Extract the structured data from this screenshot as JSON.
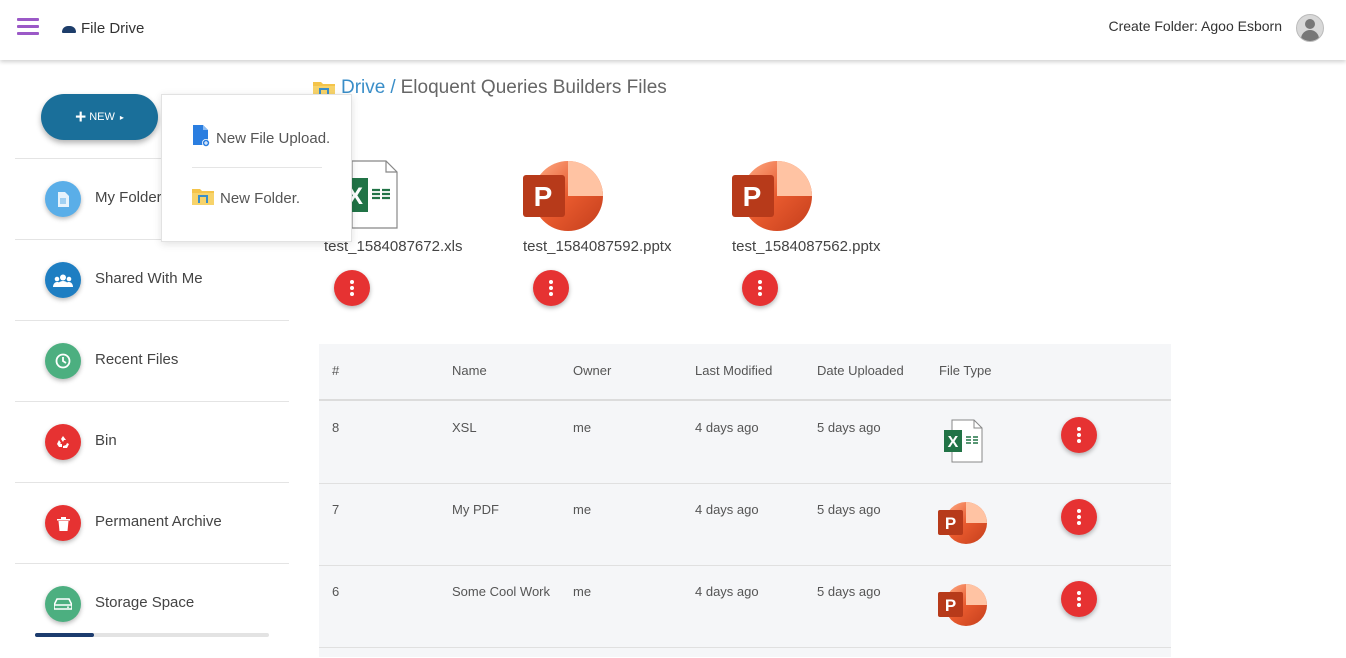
{
  "header": {
    "brand": "File Drive",
    "create_folder": "Create Folder: Agoo Esborn"
  },
  "sidebar": {
    "new_label": "NEW",
    "items": [
      {
        "label": "My Folders",
        "icon": "file-icon",
        "color": "#5aaee8"
      },
      {
        "label": "Shared With Me",
        "icon": "group-icon",
        "color": "#1e7ec2"
      },
      {
        "label": "Recent Files",
        "icon": "clock-icon",
        "color": "#4caf80"
      },
      {
        "label": "Bin",
        "icon": "recycle-icon",
        "color": "#e63232"
      },
      {
        "label": "Permanent Archive",
        "icon": "trash-icon",
        "color": "#e63232"
      },
      {
        "label": "Storage Space",
        "icon": "drive-icon",
        "color": "#4caf80"
      }
    ],
    "storage_used_fraction": 0.25
  },
  "dropdown": {
    "items": [
      {
        "label": "New File Upload.",
        "icon": "file-upload-icon"
      },
      {
        "label": "New Folder.",
        "icon": "folder-icon"
      }
    ]
  },
  "breadcrumb": {
    "root": "Drive",
    "separator": "/",
    "current": "Eloquent Queries Builders Files"
  },
  "files": [
    {
      "name": "test_1584087672.xls",
      "type": "excel"
    },
    {
      "name": "test_1584087592.pptx",
      "type": "powerpoint"
    },
    {
      "name": "test_1584087562.pptx",
      "type": "powerpoint"
    }
  ],
  "table": {
    "headers": [
      "#",
      "Name",
      "Owner",
      "Last Modified",
      "Date Uploaded",
      "File Type"
    ],
    "rows": [
      {
        "id": "8",
        "name": "XSL",
        "owner": "me",
        "modified": "4 days ago",
        "uploaded": "5 days ago",
        "type": "excel"
      },
      {
        "id": "7",
        "name": "My PDF",
        "owner": "me",
        "modified": "4 days ago",
        "uploaded": "5 days ago",
        "type": "powerpoint"
      },
      {
        "id": "6",
        "name": "Some Cool Work",
        "owner": "me",
        "modified": "4 days ago",
        "uploaded": "5 days ago",
        "type": "powerpoint"
      }
    ]
  },
  "colors": {
    "accent": "#1a6f9a",
    "action_red": "#e63232",
    "link": "#3a8ec8",
    "menu_purple": "#9b59c7"
  }
}
